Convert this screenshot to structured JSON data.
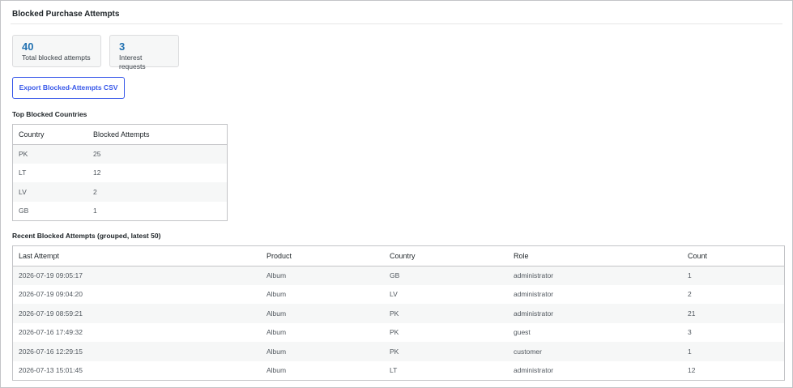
{
  "panel": {
    "title": "Blocked Purchase Attempts"
  },
  "stats": [
    {
      "value": "40",
      "label": "Total blocked attempts"
    },
    {
      "value": "3",
      "label": "Interest requests"
    }
  ],
  "export_button": {
    "label": "Export Blocked-Attempts CSV"
  },
  "top_countries": {
    "heading": "Top Blocked Countries",
    "columns": [
      "Country",
      "Blocked Attempts"
    ],
    "rows": [
      {
        "country": "PK",
        "attempts": "25"
      },
      {
        "country": "LT",
        "attempts": "12"
      },
      {
        "country": "LV",
        "attempts": "2"
      },
      {
        "country": "GB",
        "attempts": "1"
      }
    ]
  },
  "recent": {
    "heading": "Recent Blocked Attempts (grouped, latest 50)",
    "columns": [
      "Last Attempt",
      "Product",
      "Country",
      "Role",
      "Count"
    ],
    "rows": [
      {
        "last": "2026-07-19 09:05:17",
        "product": "Album",
        "country": "GB",
        "role": "administrator",
        "count": "1"
      },
      {
        "last": "2026-07-19 09:04:20",
        "product": "Album",
        "country": "LV",
        "role": "administrator",
        "count": "2"
      },
      {
        "last": "2026-07-19 08:59:21",
        "product": "Album",
        "country": "PK",
        "role": "administrator",
        "count": "21"
      },
      {
        "last": "2026-07-16 17:49:32",
        "product": "Album",
        "country": "PK",
        "role": "guest",
        "count": "3"
      },
      {
        "last": "2026-07-16 12:29:15",
        "product": "Album",
        "country": "PK",
        "role": "customer",
        "count": "1"
      },
      {
        "last": "2026-07-13 15:01:45",
        "product": "Album",
        "country": "LT",
        "role": "administrator",
        "count": "12"
      }
    ]
  },
  "colors": {
    "accent": "#2271b1",
    "button": "#3858e9",
    "border": "#c3c4c7",
    "stripe": "#f6f7f7"
  }
}
